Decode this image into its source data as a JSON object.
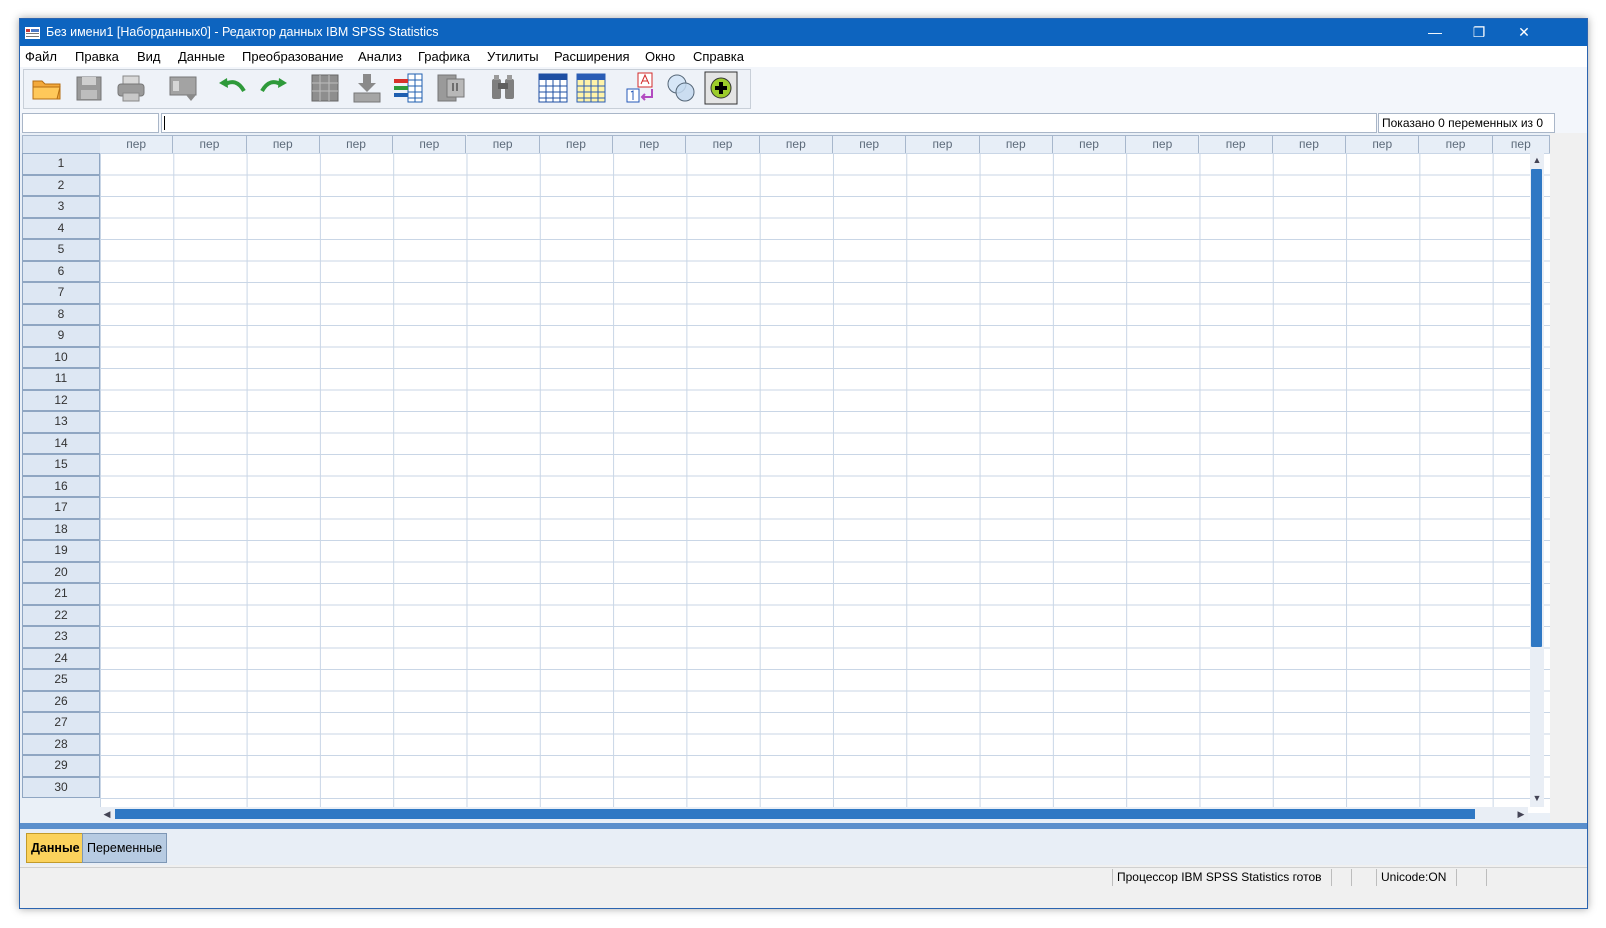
{
  "window": {
    "title": "Без имени1 [Наборданных0] - Редактор данных IBM SPSS Statistics",
    "minimize_glyph": "—",
    "restore_glyph": "❐",
    "close_glyph": "✕"
  },
  "menubar": {
    "items": [
      "Файл",
      "Правка",
      "Вид",
      "Данные",
      "Преобразование",
      "Анализ",
      "Графика",
      "Утилиты",
      "Расширения",
      "Окно",
      "Справка"
    ]
  },
  "toolbar": {
    "icons": [
      "open-folder-icon",
      "save-icon",
      "print-icon",
      "dialog-recall-icon",
      "undo-icon",
      "redo-icon",
      "go-to-case-icon",
      "insert-case-icon",
      "insert-variable-icon",
      "split-file-icon",
      "find-icon",
      "data-view-icon",
      "variable-view-icon",
      "value-labels-icon",
      "use-variable-sets-icon",
      "spelling-icon"
    ]
  },
  "formula_bar": {
    "cell_reference": "",
    "cell_value": "",
    "shown_vars": "Показано 0 переменных из 0"
  },
  "grid": {
    "column_header": "пер",
    "column_count": 20,
    "rows": [
      "1",
      "2",
      "3",
      "4",
      "5",
      "6",
      "7",
      "8",
      "9",
      "10",
      "11",
      "12",
      "13",
      "14",
      "15",
      "16",
      "17",
      "18",
      "19",
      "20",
      "21",
      "22",
      "23",
      "24",
      "25",
      "26",
      "27",
      "28",
      "29",
      "30"
    ]
  },
  "tabs": {
    "data": "Данные",
    "variables": "Переменные"
  },
  "status": {
    "processor": "Процессор IBM SPSS Statistics  готов",
    "unicode": "Unicode:ON"
  },
  "colors": {
    "title_bar": "#0d64bf",
    "active_tab": "#fbd25c",
    "scroll_thumb": "#2f78c4"
  }
}
